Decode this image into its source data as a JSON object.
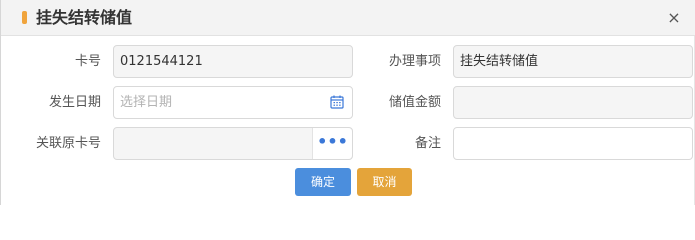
{
  "dialog": {
    "title": "挂失结转储值",
    "close_glyph": "×"
  },
  "form": {
    "card_no": {
      "label": "卡号",
      "value": "0121544121"
    },
    "item": {
      "label": "办理事项",
      "value": "挂失结转储值"
    },
    "date": {
      "label": "发生日期",
      "placeholder": "选择日期",
      "value": ""
    },
    "balance": {
      "label": "储值金额",
      "value": ""
    },
    "linked_card": {
      "label": "关联原卡号",
      "value": "",
      "button": "•••"
    },
    "remark": {
      "label": "备注",
      "value": ""
    }
  },
  "buttons": {
    "ok": "确定",
    "cancel": "取消"
  },
  "colors": {
    "accent": "#f0a43c",
    "ok_button": "#4b8edd",
    "cancel_button": "#e4a43a",
    "dots": "#3b78d8"
  },
  "icons": {
    "date": "calendar-icon",
    "close": "close-icon",
    "more": "more-dots-icon"
  }
}
